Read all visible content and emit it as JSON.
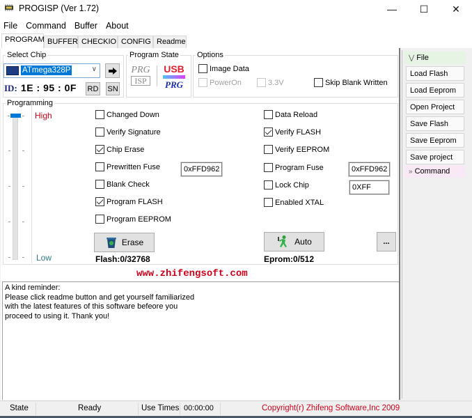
{
  "window": {
    "title": "PROGISP (Ver 1.72)",
    "minimize_glyph": "—",
    "maximize_glyph": "☐",
    "close_glyph": "✕"
  },
  "menu": [
    "File",
    "Command",
    "Buffer",
    "About"
  ],
  "tabs": [
    {
      "label": "PROGRAM",
      "active": true
    },
    {
      "label": "BUFFER",
      "active": false
    },
    {
      "label": "CHECKIO",
      "active": false
    },
    {
      "label": "CONFIG",
      "active": false
    },
    {
      "label": "Readme",
      "active": false
    }
  ],
  "select_chip": {
    "group_label": "Select Chip",
    "selected_chip": "ATmega328P",
    "go_button_icon": "arrow-right-icon",
    "id_label": "ID:",
    "id_value": "1E : 95 : 0F",
    "rd_label": "RD",
    "sn_label": "SN"
  },
  "program_state": {
    "group_label": "Program State",
    "isp_logo_top": "PRG",
    "isp_logo_bottom": "ISP",
    "usb_logo_top": "USB",
    "usb_logo_bottom": "PRG"
  },
  "options": {
    "group_label": "Options",
    "image_data": {
      "label": "Image Data",
      "checked": false,
      "enabled": true
    },
    "power_on": {
      "label": "PowerOn",
      "checked": false,
      "enabled": false
    },
    "v33": {
      "label": "3.3V",
      "checked": false,
      "enabled": false
    },
    "skip_blank": {
      "label": "Skip Blank Written",
      "checked": false,
      "enabled": true
    }
  },
  "programming": {
    "group_label": "Programming",
    "speed_high_label": "High",
    "speed_low_label": "Low",
    "speed_level": "High",
    "left_checks": [
      {
        "label": "Changed Down",
        "checked": false
      },
      {
        "label": "Verify Signature",
        "checked": false
      },
      {
        "label": "Chip Erase",
        "checked": true
      },
      {
        "label": "Prewritten Fuse",
        "checked": false
      },
      {
        "label": "Blank Check",
        "checked": false
      },
      {
        "label": "Program FLASH",
        "checked": true
      },
      {
        "label": "Program EEPROM",
        "checked": false
      }
    ],
    "right_checks": [
      {
        "label": "Data Reload",
        "checked": false
      },
      {
        "label": "Verify FLASH",
        "checked": true
      },
      {
        "label": "Verify EEPROM",
        "checked": false
      },
      {
        "label": "Program Fuse",
        "checked": false
      },
      {
        "label": "Lock Chip",
        "checked": false
      },
      {
        "label": "Enabled XTAL",
        "checked": false
      }
    ],
    "prewritten_fuse_value": "0xFFD962",
    "program_fuse_value": "0xFFD962",
    "lock_chip_value": "0XFF",
    "erase_label": "Erase",
    "auto_label": "Auto",
    "more_label": "...",
    "flash_status": "Flash:0/32768",
    "eeprom_status": "Eprom:0/512"
  },
  "website": "www.zhifengsoft.com",
  "reminder_text": "A kind reminder:\nPlease click readme button and get yourself familiarized\nwith the latest features of this software befeore you\nproceed to using it. Thank you!",
  "side_panel": {
    "file_header": "File",
    "file_buttons": [
      "Load Flash",
      "Load Eeprom",
      "Open Project",
      "Save Flash",
      "Save Eeprom",
      "Save project"
    ],
    "command_header": "Command"
  },
  "statusbar": {
    "state_label": "State",
    "state_value": "Ready",
    "use_times_label": "Use Times",
    "use_times_value": "00:00:00",
    "copyright": "Copyright(r) Zhifeng Software,Inc 2009"
  },
  "colors": {
    "accent_red": "#d0021b",
    "selection_blue": "#0078d7",
    "low_teal": "#2e7d83"
  }
}
